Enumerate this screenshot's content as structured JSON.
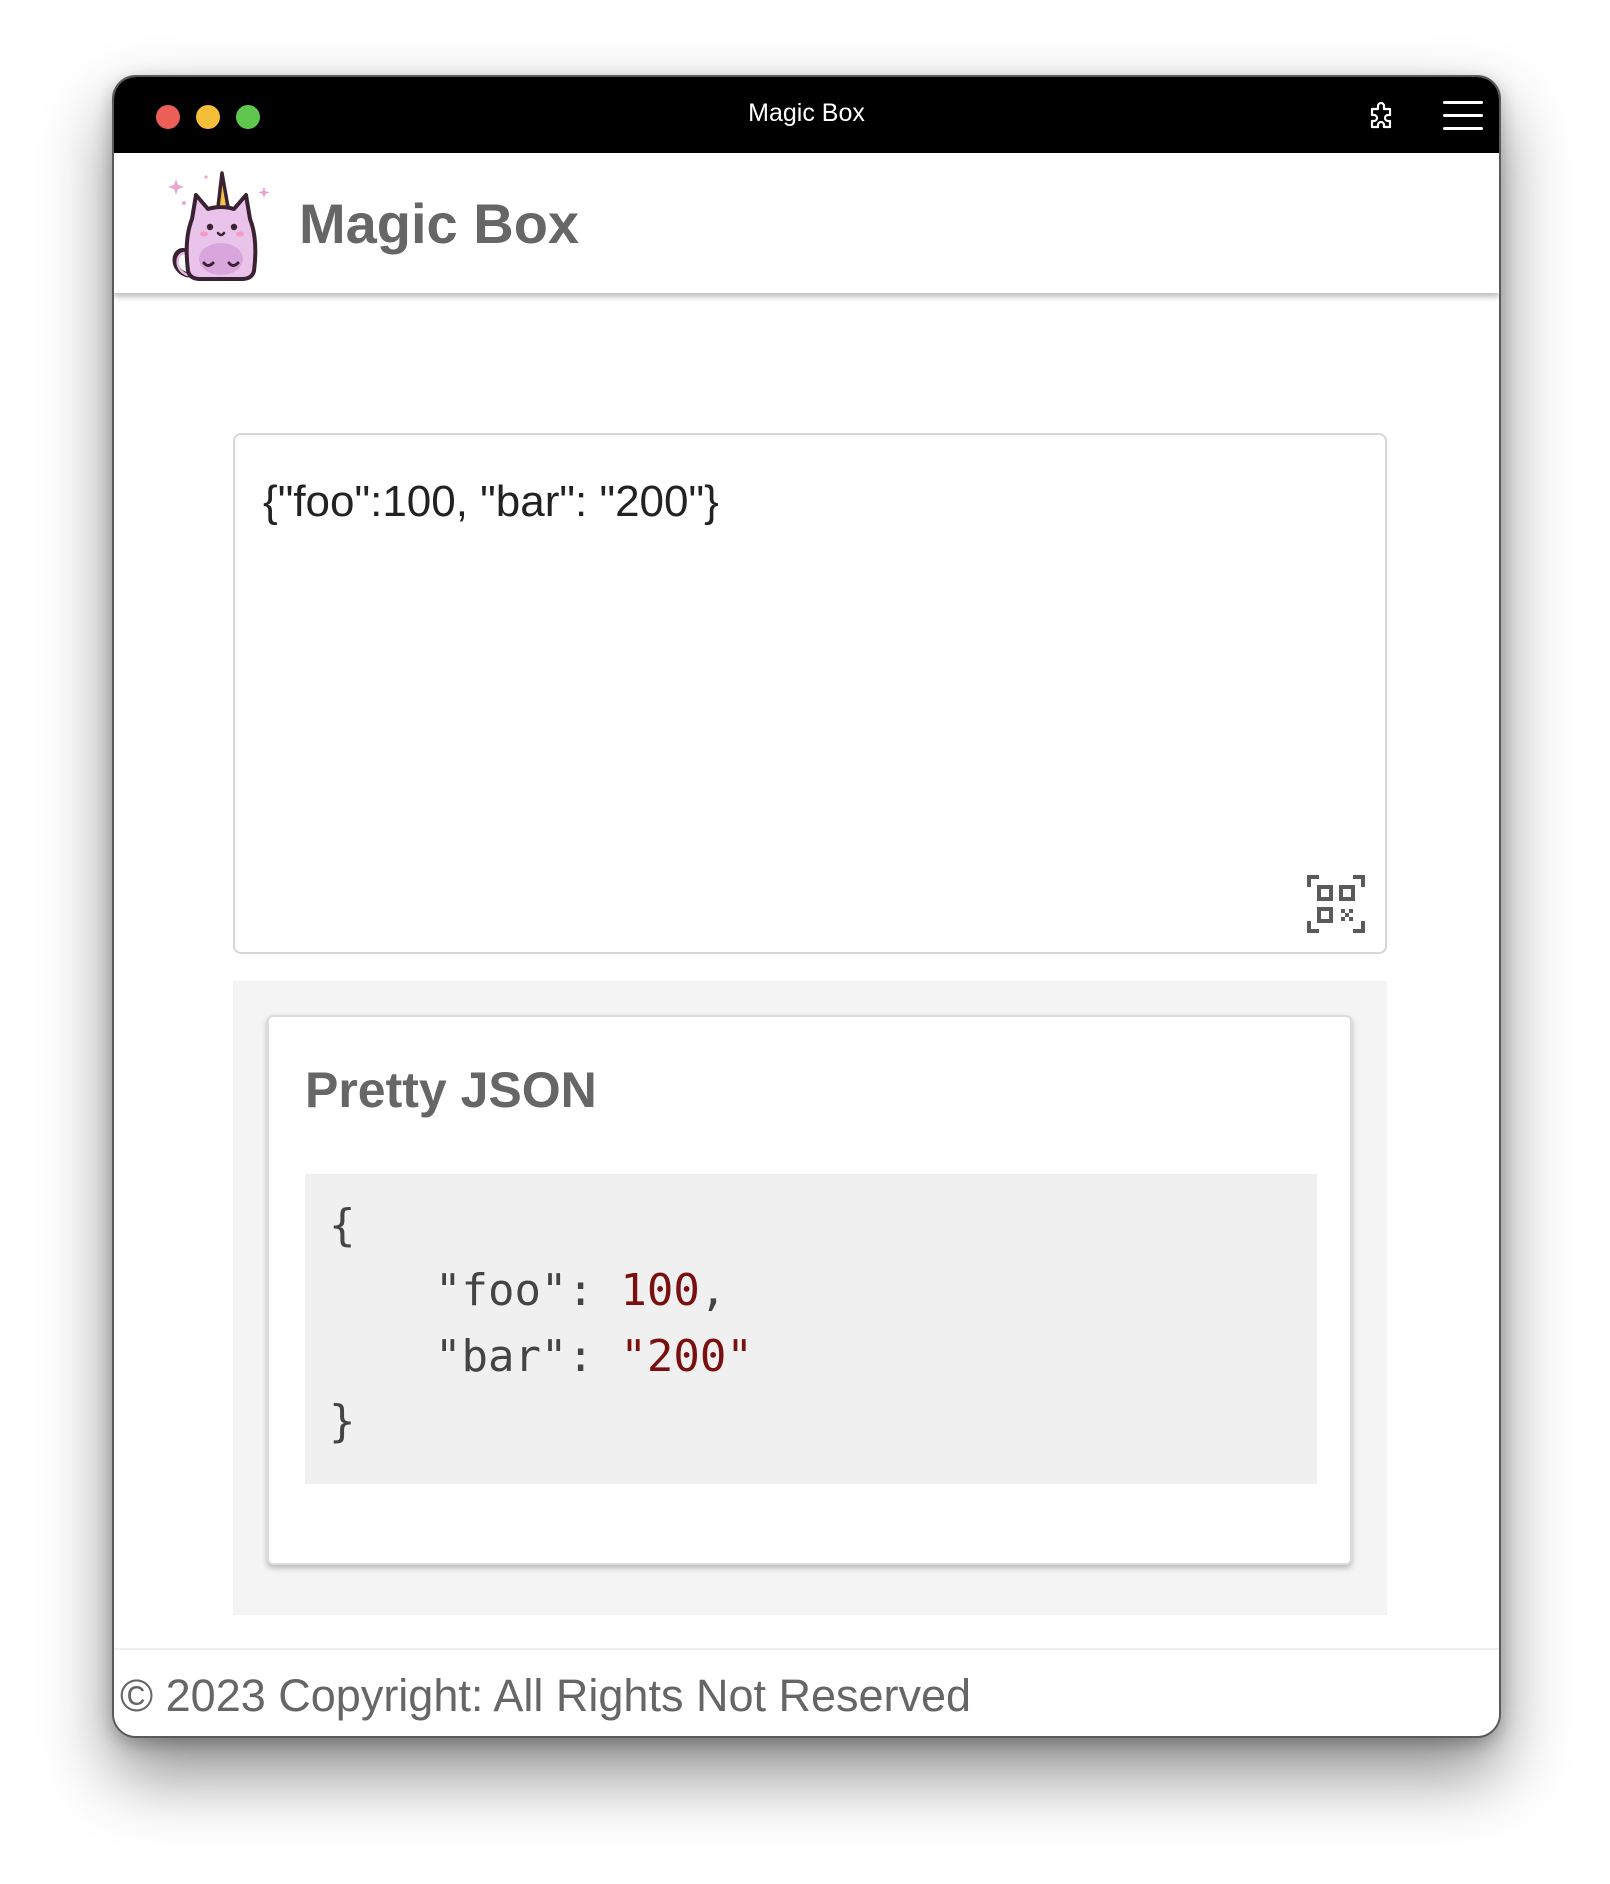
{
  "window": {
    "title": "Magic Box"
  },
  "header": {
    "app_title": "Magic Box",
    "logo_icon": "unicorn-cat-logo"
  },
  "input": {
    "value": "{\"foo\":100, \"bar\": \"200\"}",
    "qr_icon": "qr-code-icon"
  },
  "result": {
    "title": "Pretty JSON",
    "open_brace": "{",
    "close_brace": "}",
    "lines": [
      {
        "key": "\"foo\"",
        "sep": ": ",
        "value": "100",
        "trail": ","
      },
      {
        "key": "\"bar\"",
        "sep": ": ",
        "value": "\"200\"",
        "trail": ""
      }
    ]
  },
  "footer": {
    "text": "© 2023 Copyright: All Rights Not Reserved"
  },
  "colors": {
    "titlebar": "#000000",
    "accent_value": "#7a0f0f",
    "title_gray": "#666666"
  }
}
